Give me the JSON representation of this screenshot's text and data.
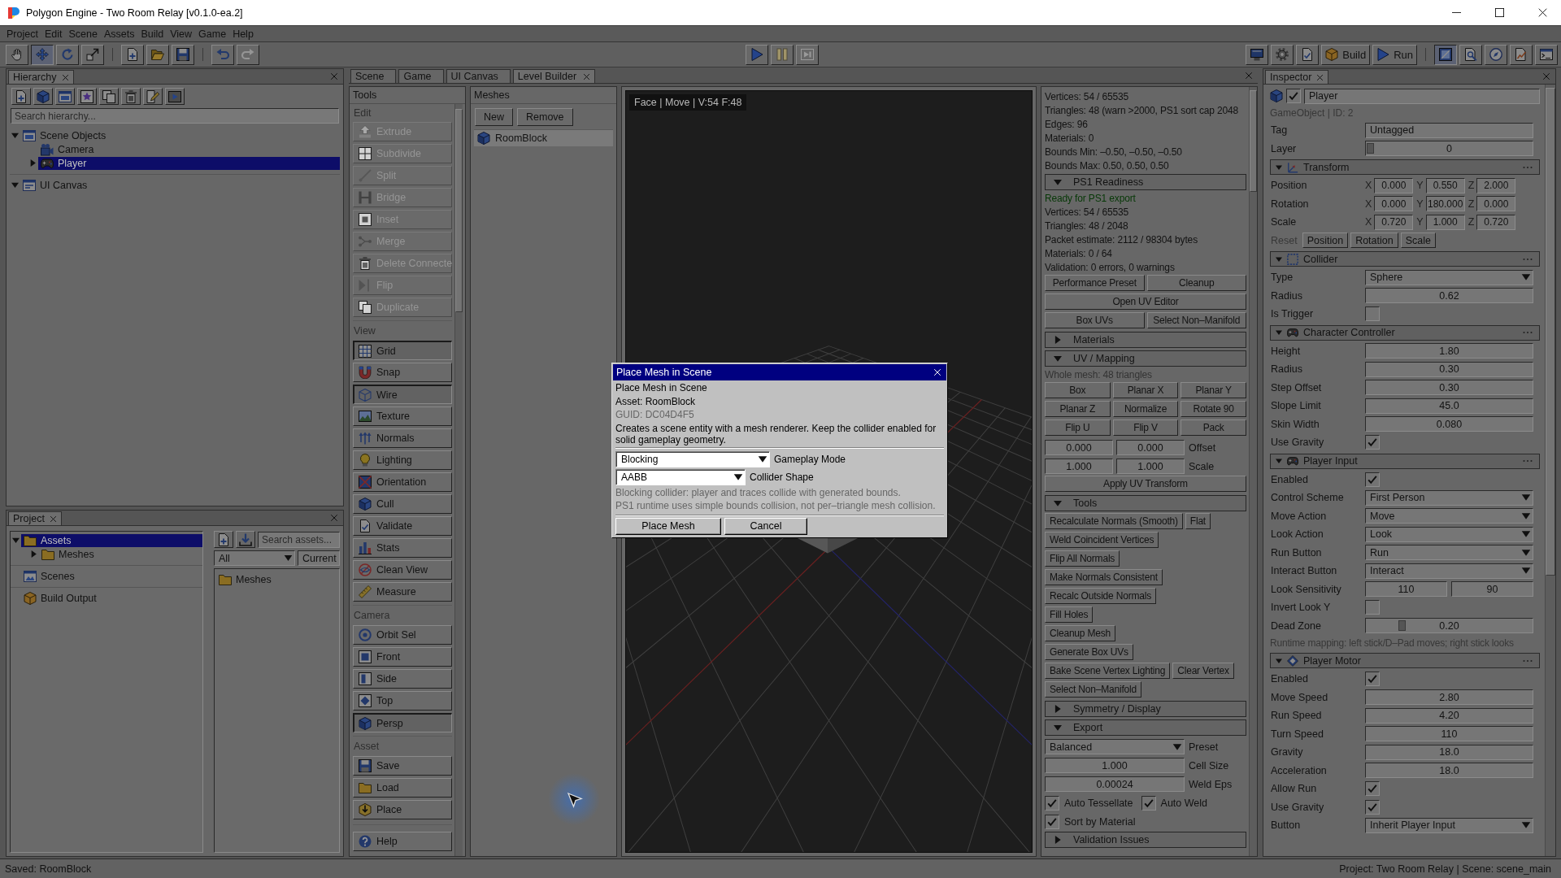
{
  "window": {
    "title": "Polygon Engine - Two Room Relay [v0.1.0-ea.2]"
  },
  "menu": [
    "Project",
    "Edit",
    "Scene",
    "Assets",
    "Build",
    "View",
    "Game",
    "Help"
  ],
  "toolbar": {
    "transform_tools": [
      {
        "selected": false
      },
      {
        "selected": true
      },
      {
        "selected": false
      },
      {
        "selected": false
      }
    ],
    "history": [
      {
        "disabled": false
      },
      {
        "disabled": true
      }
    ],
    "playback": [
      {
        "disabled": false
      },
      {
        "disabled": true
      },
      {
        "disabled": true
      }
    ],
    "build": "Build",
    "run": "Run",
    "view_modes": [
      {
        "selected": true
      },
      {
        "selected": false
      },
      {
        "selected": false
      },
      {
        "selected": false
      },
      {
        "selected": false
      }
    ]
  },
  "hierarchy": {
    "tab": "Hierarchy",
    "search": {
      "placeholder": "Search hierarchy..."
    },
    "tree": [
      {
        "label": "Scene Objects",
        "kind": "group",
        "expanded": true,
        "selected": false,
        "children": [
          {
            "label": "Camera",
            "kind": "camera",
            "selected": false
          },
          {
            "label": "Player",
            "kind": "entity",
            "expanded": false,
            "selected": true
          }
        ]
      },
      {
        "label": "UI Canvas",
        "kind": "canvas",
        "expanded": true,
        "selected": false
      }
    ]
  },
  "project": {
    "tab": "Project",
    "tree": [
      {
        "label": "Assets",
        "kind": "folder",
        "expanded": true,
        "selected": true,
        "children": [
          {
            "label": "Meshes",
            "kind": "folder",
            "expanded": false,
            "selected": false
          }
        ]
      },
      {
        "label": "Scenes",
        "kind": "scenes",
        "selected": false
      },
      {
        "label": "Build Output",
        "kind": "build",
        "selected": false
      }
    ],
    "search": {
      "placeholder": "Search assets..."
    },
    "filter": "All",
    "scope": "Current",
    "items": [
      {
        "label": "Meshes"
      }
    ]
  },
  "editor_tabs": [
    {
      "label": "Scene",
      "selected": false
    },
    {
      "label": "Game",
      "selected": false
    },
    {
      "label": "UI Canvas",
      "selected": false
    },
    {
      "label": "Level Builder",
      "selected": true
    }
  ],
  "tools": {
    "title": "Tools",
    "sections": [
      {
        "label": "Edit",
        "items": [
          {
            "label": "Extrude",
            "disabled": true,
            "on": false
          },
          {
            "label": "Subdivide",
            "disabled": true,
            "on": false
          },
          {
            "label": "Split",
            "disabled": true,
            "on": false
          },
          {
            "label": "Bridge",
            "disabled": true,
            "on": false
          },
          {
            "label": "Inset",
            "disabled": true,
            "on": false
          },
          {
            "label": "Merge",
            "disabled": true,
            "on": false
          },
          {
            "label": "Delete Connecte",
            "disabled": true,
            "on": false
          },
          {
            "label": "Flip",
            "disabled": true,
            "on": false
          },
          {
            "label": "Duplicate",
            "disabled": true,
            "on": false
          }
        ]
      },
      {
        "label": "View",
        "items": [
          {
            "label": "Grid",
            "disabled": false,
            "on": true
          },
          {
            "label": "Snap",
            "disabled": false,
            "on": false
          },
          {
            "label": "Wire",
            "disabled": false,
            "on": true
          },
          {
            "label": "Texture",
            "disabled": false,
            "on": false
          },
          {
            "label": "Normals",
            "disabled": false,
            "on": false
          },
          {
            "label": "Lighting",
            "disabled": false,
            "on": false
          },
          {
            "label": "Orientation",
            "disabled": false,
            "on": false
          },
          {
            "label": "Cull",
            "disabled": false,
            "on": false
          },
          {
            "label": "Validate",
            "disabled": false,
            "on": false
          },
          {
            "label": "Stats",
            "disabled": false,
            "on": false
          },
          {
            "label": "Clean View",
            "disabled": false,
            "on": false
          },
          {
            "label": "Measure",
            "disabled": false,
            "on": false
          }
        ]
      },
      {
        "label": "Camera",
        "items": [
          {
            "label": "Orbit Sel",
            "disabled": false,
            "on": false
          },
          {
            "label": "Front",
            "disabled": false,
            "on": false
          },
          {
            "label": "Side",
            "disabled": false,
            "on": false
          },
          {
            "label": "Top",
            "disabled": false,
            "on": false
          },
          {
            "label": "Persp",
            "disabled": false,
            "on": true
          }
        ]
      },
      {
        "label": "Asset",
        "items": [
          {
            "label": "Save",
            "disabled": false,
            "on": false
          },
          {
            "label": "Load",
            "disabled": false,
            "on": false
          },
          {
            "label": "Place",
            "disabled": false,
            "on": false
          }
        ]
      },
      {
        "items": [
          {
            "label": "Help",
            "disabled": false,
            "on": false
          }
        ]
      }
    ]
  },
  "meshes": {
    "title": "Meshes",
    "buttons": [
      "New",
      "Remove"
    ],
    "items": [
      {
        "label": "RoomBlock",
        "selected": true
      }
    ]
  },
  "viewport": {
    "overlay": "Face | Move | V:54 F:48"
  },
  "dialog": {
    "title": "Place Mesh in Scene",
    "heading": "Place Mesh in Scene",
    "asset": "Asset: RoomBlock",
    "guid": "GUID: DC04D4F5",
    "description": "Creates a scene entity with a mesh renderer. Keep the collider enabled for solid gameplay geometry.",
    "fields": [
      {
        "value": "Blocking",
        "label": "Gameplay Mode"
      },
      {
        "value": "AABB",
        "label": "Collider Shape"
      }
    ],
    "hints": [
      "Blocking collider: player and traces collide with generated bounds.",
      "PS1 runtime uses simple bounds collision, not per–triangle mesh collision."
    ],
    "buttons": [
      "Place Mesh",
      "Cancel"
    ]
  },
  "stats": {
    "lines": [
      "Vertices: 54 / 65535",
      "Triangles: 48 (warn >2000, PS1 sort cap 2048",
      "Edges: 96",
      "Materials: 0",
      "Bounds Min: –0.50, –0.50, –0.50",
      "Bounds Max: 0.50, 0.50, 0.50"
    ],
    "sections": [
      {
        "title": "PS1 Readiness",
        "expanded": true,
        "rows": [
          {
            "kind": "status",
            "text": "Ready for PS1 export"
          },
          {
            "kind": "text",
            "text": "Vertices: 54 / 65535"
          },
          {
            "kind": "text",
            "text": "Triangles: 48 / 2048"
          },
          {
            "kind": "text",
            "text": "Packet estimate: 2112 / 98304 bytes"
          },
          {
            "kind": "text",
            "text": "Materials: 0 / 64"
          },
          {
            "kind": "text",
            "text": "Validation: 0 errors, 0 warnings"
          },
          {
            "kind": "buttons",
            "buttons": [
              "Performance Preset",
              "Cleanup"
            ]
          },
          {
            "kind": "buttons",
            "buttons": [
              "Open UV Editor"
            ]
          },
          {
            "kind": "buttons",
            "buttons": [
              "Box UVs",
              "Select Non–Manifold"
            ]
          }
        ]
      },
      {
        "title": "Materials",
        "expanded": false
      },
      {
        "title": "UV / Mapping",
        "expanded": true,
        "rows": [
          {
            "kind": "note",
            "text": "Whole mesh: 48 triangles"
          },
          {
            "kind": "buttons",
            "buttons": [
              "Box",
              "Planar X",
              "Planar Y"
            ]
          },
          {
            "kind": "buttons",
            "buttons": [
              "Planar Z",
              "Normalize",
              "Rotate 90"
            ]
          },
          {
            "kind": "buttons",
            "buttons": [
              "Flip U",
              "Flip V",
              "Pack"
            ]
          },
          {
            "kind": "fields",
            "values": [
              "0.000",
              "0.000"
            ],
            "label": "Offset"
          },
          {
            "kind": "fields",
            "values": [
              "1.000",
              "1.000"
            ],
            "label": "Scale"
          },
          {
            "kind": "buttons",
            "buttons": [
              "Apply UV Transform"
            ]
          }
        ]
      },
      {
        "title": "Tools",
        "expanded": true,
        "rows": [
          {
            "kind": "compact",
            "buttons": [
              "Recalculate Normals (Smooth)",
              "Flat"
            ]
          },
          {
            "kind": "compact",
            "buttons": [
              "Weld Coincident Vertices"
            ]
          },
          {
            "kind": "compact",
            "buttons": [
              "Flip All Normals"
            ]
          },
          {
            "kind": "compact",
            "buttons": [
              "Make Normals Consistent"
            ]
          },
          {
            "kind": "compact",
            "buttons": [
              "Recalc Outside Normals"
            ]
          },
          {
            "kind": "compact",
            "buttons": [
              "Fill Holes"
            ]
          },
          {
            "kind": "compact",
            "buttons": [
              "Cleanup Mesh"
            ]
          },
          {
            "kind": "compact",
            "buttons": [
              "Generate Box UVs"
            ]
          },
          {
            "kind": "compact",
            "buttons": [
              "Bake Scene Vertex Lighting",
              "Clear Vertex"
            ]
          },
          {
            "kind": "compact",
            "buttons": [
              "Select Non–Manifold"
            ]
          }
        ]
      },
      {
        "title": "Symmetry / Display",
        "expanded": false
      },
      {
        "title": "Export",
        "expanded": true,
        "rows": [
          {
            "kind": "dropdown",
            "value": "Balanced",
            "label": "Preset"
          },
          {
            "kind": "fields",
            "values": [
              "1.000"
            ],
            "label": "Cell Size"
          },
          {
            "kind": "fields",
            "values": [
              "0.00024"
            ],
            "label": "Weld Eps"
          },
          {
            "kind": "checks",
            "checks": [
              {
                "label": "Auto Tessellate",
                "checked": true
              },
              {
                "label": "Auto Weld",
                "checked": true
              }
            ]
          },
          {
            "kind": "checks",
            "checks": [
              {
                "label": "Sort by Material",
                "checked": true
              }
            ]
          }
        ]
      },
      {
        "title": "Validation Issues",
        "expanded": false
      }
    ]
  },
  "inspector": {
    "tab": "Inspector",
    "object": {
      "active": true,
      "name": "Player",
      "info": "GameObject | ID: 2"
    },
    "rows": [
      {
        "kind": "text",
        "label": "Tag",
        "value": "Untagged"
      },
      {
        "kind": "slider",
        "label": "Layer",
        "value": "0",
        "level": 0
      }
    ],
    "components": [
      {
        "title": "Transform",
        "expanded": true,
        "rows": [
          {
            "kind": "vec3",
            "label": "Position",
            "axes": [
              {
                "axis": "X",
                "value": "0.000"
              },
              {
                "axis": "Y",
                "value": "0.550"
              },
              {
                "axis": "Z",
                "value": "2.000"
              }
            ]
          },
          {
            "kind": "vec3",
            "label": "Rotation",
            "axes": [
              {
                "axis": "X",
                "value": "0.000"
              },
              {
                "axis": "Y",
                "value": "180.000"
              },
              {
                "axis": "Z",
                "value": "0.000"
              }
            ]
          },
          {
            "kind": "vec3",
            "label": "Scale",
            "axes": [
              {
                "axis": "X",
                "value": "0.720"
              },
              {
                "axis": "Y",
                "value": "1.000"
              },
              {
                "axis": "Z",
                "value": "0.720"
              }
            ]
          },
          {
            "kind": "reset",
            "label": "Reset",
            "buttons": [
              "Position",
              "Rotation",
              "Scale"
            ]
          }
        ]
      },
      {
        "title": "Collider",
        "expanded": true,
        "rows": [
          {
            "kind": "dropdown",
            "label": "Type",
            "value": "Sphere"
          },
          {
            "kind": "number",
            "label": "Radius",
            "value": "0.62"
          },
          {
            "kind": "checkbox",
            "label": "Is Trigger",
            "checked": false
          }
        ]
      },
      {
        "title": "Character Controller",
        "expanded": true,
        "rows": [
          {
            "kind": "number",
            "label": "Height",
            "value": "1.80"
          },
          {
            "kind": "number",
            "label": "Radius",
            "value": "0.30"
          },
          {
            "kind": "number",
            "label": "Step Offset",
            "value": "0.30"
          },
          {
            "kind": "number",
            "label": "Slope Limit",
            "value": "45.0"
          },
          {
            "kind": "number",
            "label": "Skin Width",
            "value": "0.080"
          },
          {
            "kind": "checkbox",
            "label": "Use Gravity",
            "checked": true
          }
        ]
      },
      {
        "title": "Player Input",
        "expanded": true,
        "rows": [
          {
            "kind": "checkbox",
            "label": "Enabled",
            "checked": true
          },
          {
            "kind": "dropdown",
            "label": "Control Scheme",
            "value": "First Person"
          },
          {
            "kind": "dropdown",
            "label": "Move Action",
            "value": "Move"
          },
          {
            "kind": "dropdown",
            "label": "Look Action",
            "value": "Look"
          },
          {
            "kind": "dropdown",
            "label": "Run Button",
            "value": "Run"
          },
          {
            "kind": "dropdown",
            "label": "Interact Button",
            "value": "Interact"
          },
          {
            "kind": "pair",
            "label": "Look Sensitivity",
            "values": [
              "110",
              "90"
            ]
          },
          {
            "kind": "checkbox",
            "label": "Invert Look Y",
            "checked": false
          },
          {
            "kind": "slider",
            "label": "Dead Zone",
            "value": "0.20",
            "level": 0.2
          },
          {
            "kind": "note",
            "text": "Runtime mapping: left stick/D–Pad moves; right stick looks"
          }
        ]
      },
      {
        "title": "Player Motor",
        "expanded": true,
        "rows": [
          {
            "kind": "checkbox",
            "label": "Enabled",
            "checked": true
          },
          {
            "kind": "number",
            "label": "Move Speed",
            "value": "2.80"
          },
          {
            "kind": "number",
            "label": "Run Speed",
            "value": "4.20"
          },
          {
            "kind": "number",
            "label": "Turn Speed",
            "value": "110"
          },
          {
            "kind": "number",
            "label": "Gravity",
            "value": "18.0"
          },
          {
            "kind": "number",
            "label": "Acceleration",
            "value": "18.0"
          },
          {
            "kind": "checkbox",
            "label": "Allow Run",
            "checked": true
          },
          {
            "kind": "checkbox",
            "label": "Use Gravity",
            "checked": true
          },
          {
            "kind": "dropdown",
            "label": "Button",
            "value": "Inherit Player Input"
          }
        ]
      }
    ]
  },
  "status_bar": {
    "left": "Saved: RoomBlock",
    "right": "Project: Two Room Relay | Scene: scene_main"
  }
}
